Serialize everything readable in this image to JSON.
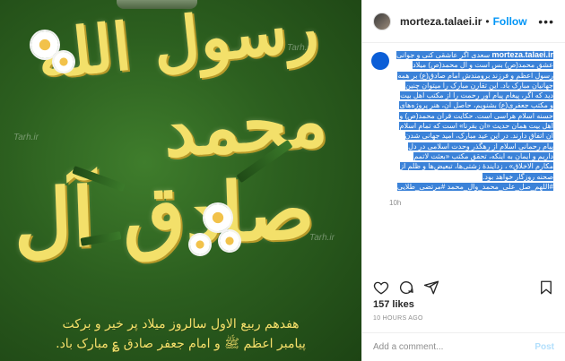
{
  "image": {
    "watermarks": [
      "Tarh.ir",
      "Tarh.ir",
      "Tarh.ir"
    ],
    "calligraphy": [
      "رسول الله",
      "محمد",
      "صادق آل"
    ],
    "caption_lines": [
      "هفدهم ربیع الاول سالروز میلاد پر خیر و برکت",
      "پیامبر اعظم ﷺ و امام جعفر صادق ؏ مبارک باد."
    ]
  },
  "header": {
    "username": "morteza.talaei.ir",
    "separator": "•",
    "follow_label": "Follow",
    "more_icon": "more-horizontal-icon"
  },
  "caption": {
    "username": "morteza.talaei.ir",
    "text": "سعدی اگر عاشقی کنی و جوانی عشق محمد(ص) بس است و آل محمد(ص) میلاد رسول اعظم و فرزند برومندش امام صادق(ع) بر همه جهانیان مبارک باد. این تقارن مبارک را میتوان چنین دید که اگر، پیغام پیام آور رحمت را از مکتب اهل بیت و مکتب جعفری(ع) بشنویم، حاصل آن، هنر پروژه‌های حسنه اسلام هراسی است. حکایت قرآن محمد(ص) و اهل بیت همان حدیث «ان بقرنا» است که تمام اسلام آن اتفاق دارند. در این عید مبارک، امید جهانی شدن پیام رحمانی اسلام از رهگذر وحدت اسلامی در دل داریم و ایمان به اینکه، تحقق مکتب «بعثت لاتمم مکارم الاخلاق» ، زدایندهٔ زشتی‌ها، تبعیض‌ها و ظلم از صحنه روزگار خواهد بود. #اللهم_صل_علی_محمد_وال_محمد #مرتضی_طلایی",
    "time": "10h"
  },
  "actions": {
    "icons": [
      "heart-icon",
      "comment-icon",
      "share-icon",
      "bookmark-icon"
    ]
  },
  "likes": "157 likes",
  "timestamp": "10 HOURS AGO",
  "comment_box": {
    "placeholder": "Add a comment...",
    "post_label": "Post"
  },
  "colors": {
    "accent": "#0095f6",
    "highlight": "#3b82d8",
    "gold": "#f3e06a",
    "green": "#2c5f1f"
  }
}
